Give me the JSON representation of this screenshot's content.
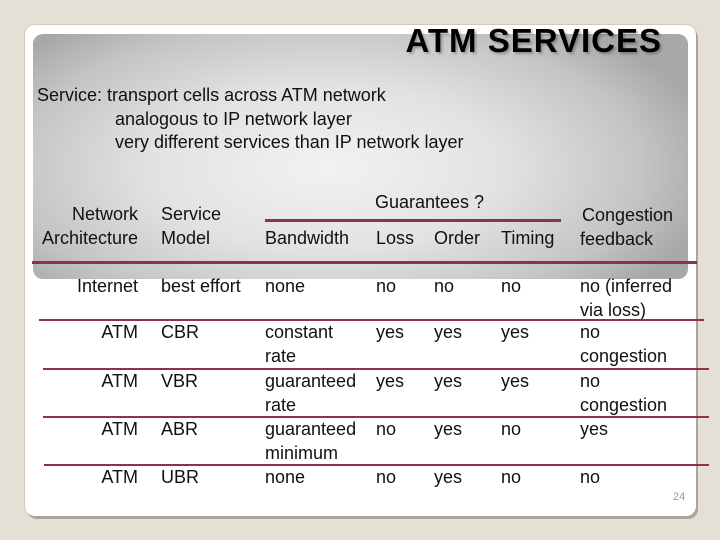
{
  "slide": {
    "title": "ATM SERVICES",
    "intro": [
      "Service: transport cells across ATM network",
      "analogous to IP network layer",
      "very different services than IP network layer"
    ],
    "page_number": "24"
  },
  "table": {
    "headers": {
      "arch": [
        "Network",
        "Architecture"
      ],
      "model": [
        "Service",
        "Model"
      ],
      "guarantees_group": "Guarantees ?",
      "bandwidth": "Bandwidth",
      "loss": "Loss",
      "order": "Order",
      "timing": "Timing",
      "congestion": [
        "Congestion",
        "feedback"
      ]
    },
    "rows": [
      {
        "arch": "Internet",
        "model": "best effort",
        "bandwidth": [
          "none"
        ],
        "loss": "no",
        "order": "no",
        "timing": "no",
        "congestion": [
          "no (inferred",
          "via loss)"
        ]
      },
      {
        "arch": "ATM",
        "model": "CBR",
        "bandwidth": [
          "constant",
          "rate"
        ],
        "loss": "yes",
        "order": "yes",
        "timing": "yes",
        "congestion": [
          "no",
          "congestion"
        ]
      },
      {
        "arch": "ATM",
        "model": "VBR",
        "bandwidth": [
          "guaranteed",
          "rate"
        ],
        "loss": "yes",
        "order": "yes",
        "timing": "yes",
        "congestion": [
          "no",
          "congestion"
        ]
      },
      {
        "arch": "ATM",
        "model": "ABR",
        "bandwidth": [
          "guaranteed",
          "minimum"
        ],
        "loss": "no",
        "order": "yes",
        "timing": "no",
        "congestion": [
          "yes"
        ]
      },
      {
        "arch": "ATM",
        "model": "UBR",
        "bandwidth": [
          "none"
        ],
        "loss": "no",
        "order": "yes",
        "timing": "no",
        "congestion": [
          "no"
        ]
      }
    ]
  },
  "colors": {
    "rule": "#8b3443",
    "background": "#e5e0d6"
  }
}
